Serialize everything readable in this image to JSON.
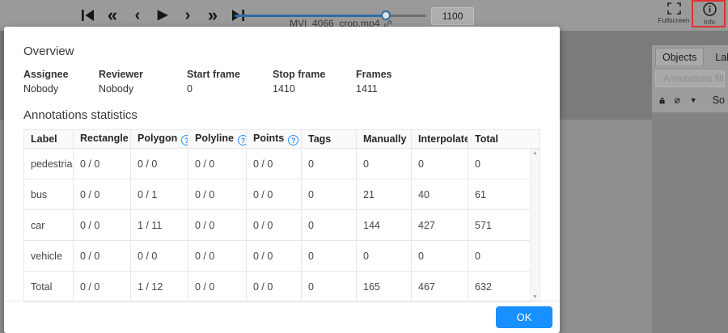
{
  "topbar": {
    "controls": [
      {
        "name": "first-frame-button"
      },
      {
        "name": "backward-jump-button",
        "glyph": "«"
      },
      {
        "name": "previous-frame-button",
        "glyph": "‹"
      },
      {
        "name": "play-button",
        "glyph": "▶"
      },
      {
        "name": "next-frame-button",
        "glyph": "›"
      },
      {
        "name": "forward-jump-button",
        "glyph": "»"
      },
      {
        "name": "last-frame-button"
      }
    ],
    "slider_percent": 79,
    "filename": "MVI_4066_crop.mp4",
    "frame_value": "1100",
    "fullscreen_label": "Fullscreen",
    "info_label": "Info"
  },
  "sidebar": {
    "tabs": [
      "Objects",
      "Labels"
    ],
    "filter_placeholder": "Annotations filter",
    "sort_label": "So",
    "caret_glyph": "▼"
  },
  "modal": {
    "overview": {
      "title": "Overview",
      "fields": [
        {
          "label": "Assignee",
          "value": "Nobody"
        },
        {
          "label": "Reviewer",
          "value": "Nobody"
        },
        {
          "label": "Start frame",
          "value": "0"
        },
        {
          "label": "Stop frame",
          "value": "1410"
        },
        {
          "label": "Frames",
          "value": "1411"
        }
      ]
    },
    "stats": {
      "title": "Annotations statistics",
      "headers": [
        {
          "label": "Label",
          "help": false
        },
        {
          "label": "Rectangle",
          "help": true
        },
        {
          "label": "Polygon",
          "help": true
        },
        {
          "label": "Polyline",
          "help": true
        },
        {
          "label": "Points",
          "help": true
        },
        {
          "label": "Tags",
          "help": false
        },
        {
          "label": "Manually",
          "help": false
        },
        {
          "label": "Interpolated",
          "help": false
        },
        {
          "label": "Total",
          "help": false
        }
      ],
      "help_glyph": "?",
      "rows": [
        [
          "pedestrian",
          "0 / 0",
          "0 / 0",
          "0 / 0",
          "0 / 0",
          "0",
          "0",
          "0",
          "0"
        ],
        [
          "bus",
          "0 / 0",
          "0 / 1",
          "0 / 0",
          "0 / 0",
          "0",
          "21",
          "40",
          "61"
        ],
        [
          "car",
          "0 / 0",
          "1 / 11",
          "0 / 0",
          "0 / 0",
          "0",
          "144",
          "427",
          "571"
        ],
        [
          "vehicle",
          "0 / 0",
          "0 / 0",
          "0 / 0",
          "0 / 0",
          "0",
          "0",
          "0",
          "0"
        ],
        [
          "Total",
          "0 / 0",
          "1 / 12",
          "0 / 0",
          "0 / 0",
          "0",
          "165",
          "467",
          "632"
        ]
      ],
      "scroll_up_glyph": "▲",
      "scroll_down_glyph": "▼"
    },
    "ok_label": "OK"
  },
  "chart_data": {
    "type": "table",
    "title": "Annotations statistics",
    "categories": [
      "pedestrian",
      "bus",
      "car",
      "vehicle",
      "Total"
    ],
    "series": [
      {
        "name": "Manually",
        "values": [
          0,
          21,
          144,
          0,
          165
        ]
      },
      {
        "name": "Interpolated",
        "values": [
          0,
          40,
          427,
          0,
          467
        ]
      },
      {
        "name": "Total",
        "values": [
          0,
          61,
          571,
          0,
          632
        ]
      }
    ]
  },
  "colors": {
    "accent_blue": "#1890ff",
    "highlight_red": "#e03131",
    "slider_blue": "#2e6da4",
    "modal_bg": "#ffffff",
    "table_border": "#e8e8e8",
    "header_row_bg": "#fafafa"
  }
}
